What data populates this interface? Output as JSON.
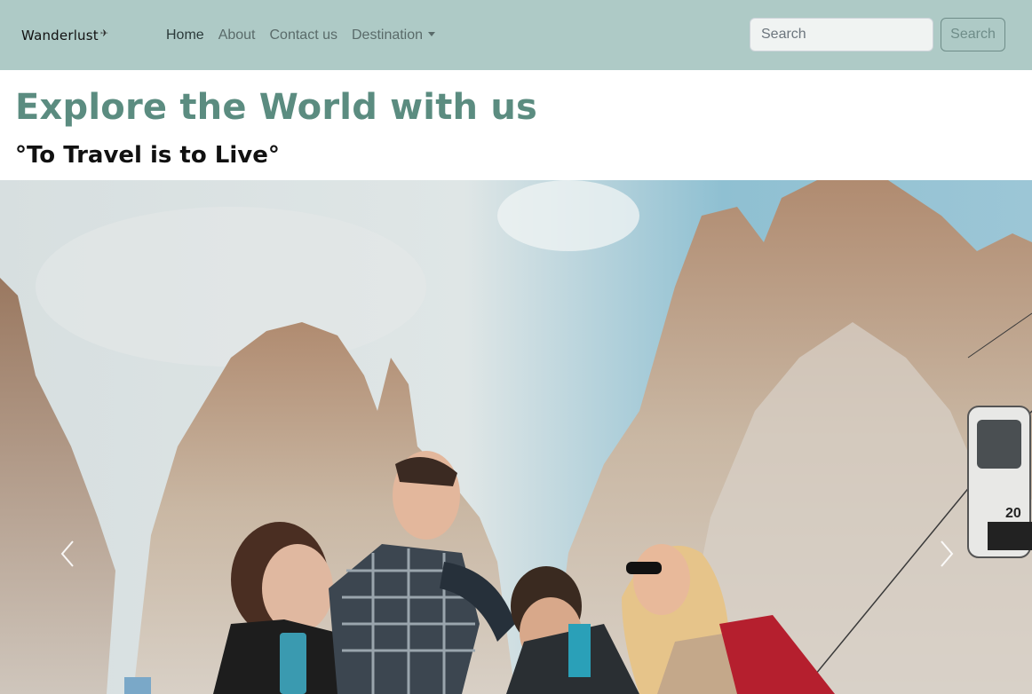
{
  "navbar": {
    "brand": "Wanderlust",
    "brand_icon": "plane-icon",
    "links": [
      {
        "label": "Home"
      },
      {
        "label": "About"
      },
      {
        "label": "Contact us"
      },
      {
        "label": "Destination"
      }
    ],
    "search": {
      "placeholder": "Search",
      "button_label": "Search"
    }
  },
  "hero": {
    "title": "Explore the World with us",
    "subtitle": "°To Travel is to Live°"
  },
  "carousel": {
    "image_description": "friends-in-mountains-photo",
    "prev_icon": "chevron-left-icon",
    "next_icon": "chevron-right-icon",
    "cable_car_number": "20"
  },
  "colors": {
    "navbar_bg": "#aecac6",
    "title_color": "#5b8c80",
    "search_btn": "#6f8d89"
  }
}
